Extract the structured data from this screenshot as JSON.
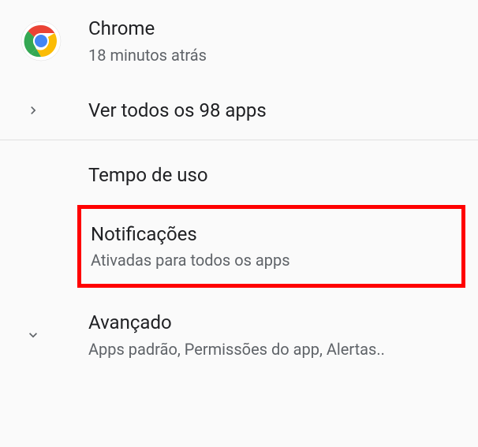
{
  "recentApp": {
    "name": "Chrome",
    "timeAgo": "18 minutos atrás"
  },
  "seeAllApps": {
    "label": "Ver todos os 98 apps"
  },
  "screenTime": {
    "label": "Tempo de uso"
  },
  "notifications": {
    "title": "Notificações",
    "subtitle": "Ativadas para todos os apps"
  },
  "advanced": {
    "title": "Avançado",
    "subtitle": "Apps padrão, Permissões do app, Alertas.."
  }
}
